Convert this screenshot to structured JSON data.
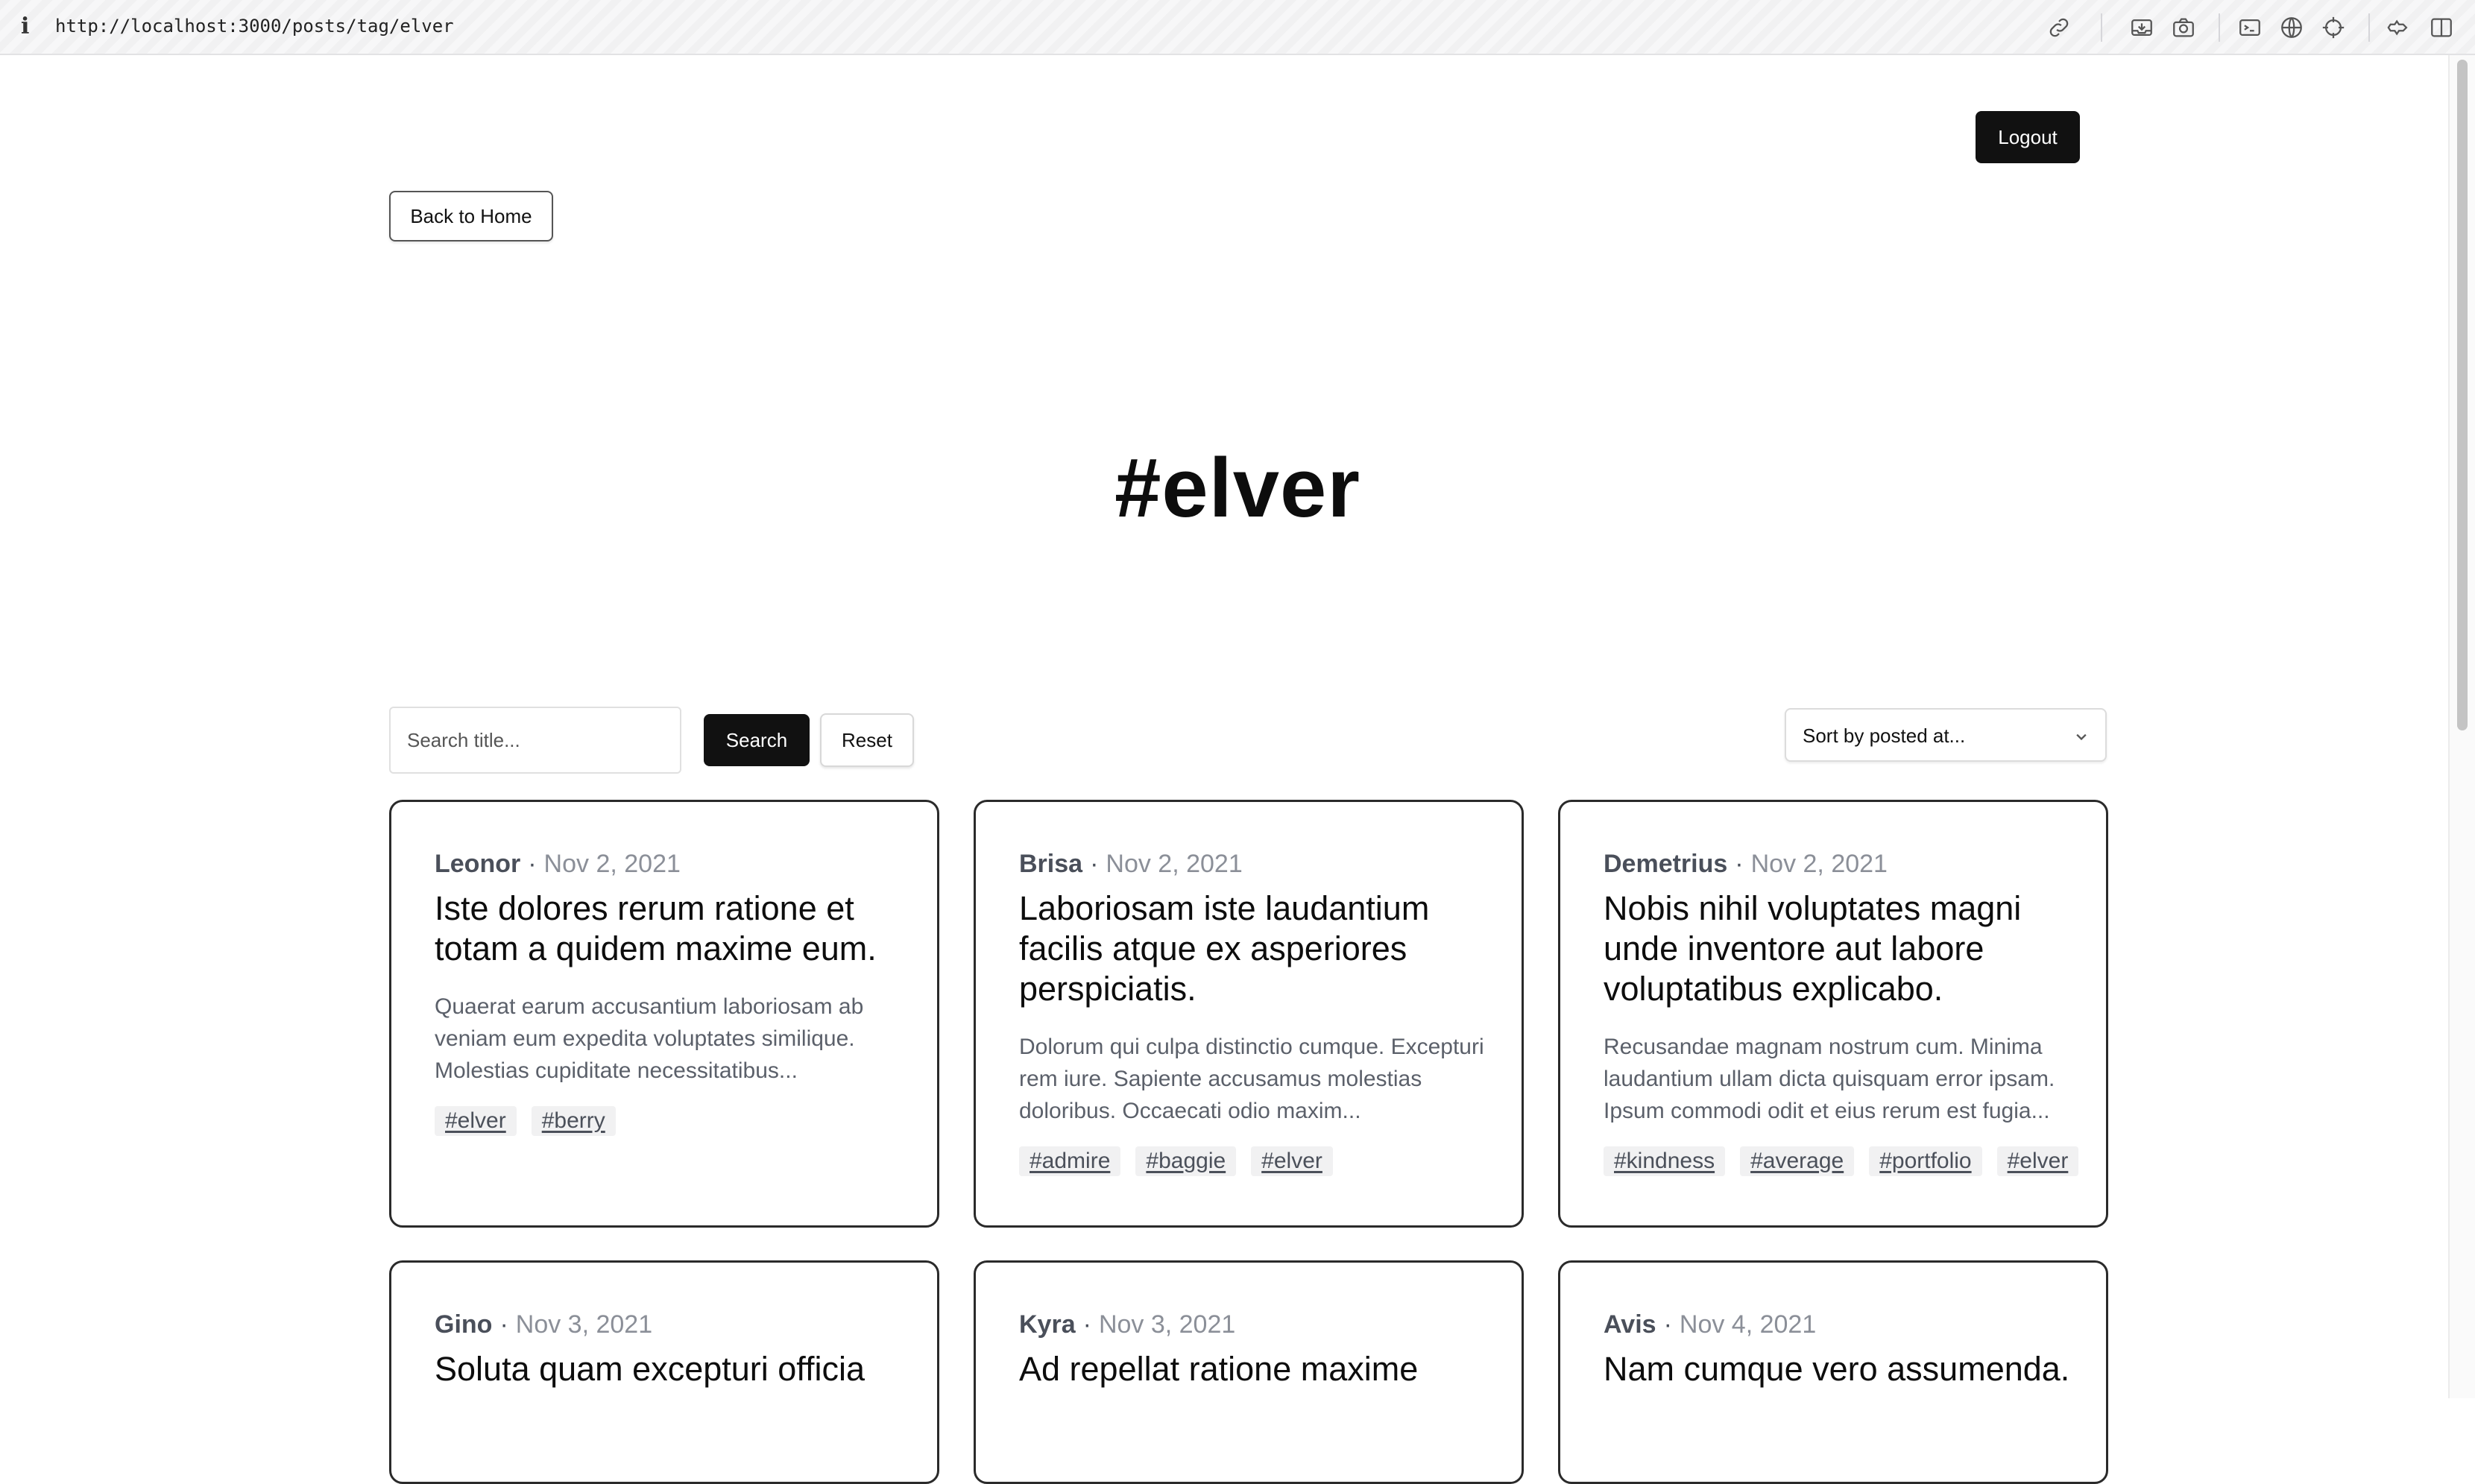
{
  "browser": {
    "url": "http://localhost:3000/posts/tag/elver",
    "info_glyph": "i",
    "toolbar_icons": [
      "link-icon",
      "inbox-icon",
      "camera-icon",
      "terminal-icon",
      "globe-icon",
      "crosshair-icon",
      "extensions-icon",
      "sidebar-icon"
    ]
  },
  "header": {
    "logout_label": "Logout",
    "back_label": "Back to Home"
  },
  "page": {
    "title": "#elver"
  },
  "toolbar": {
    "search_placeholder": "Search title...",
    "search_label": "Search",
    "reset_label": "Reset",
    "sort_label": "Sort by posted at..."
  },
  "posts": [
    {
      "author": "Leonor",
      "date": "Nov 2, 2021",
      "title": "Iste dolores rerum ratione et totam a quidem maxime eum.",
      "excerpt": "Quaerat earum accusantium laboriosam ab veniam eum expedita voluptates similique. Molestias cupiditate necessitatibus...",
      "tags": [
        "#elver",
        "#berry"
      ]
    },
    {
      "author": "Brisa",
      "date": "Nov 2, 2021",
      "title": "Laboriosam iste laudantium facilis atque ex asperiores perspiciatis.",
      "excerpt": "Dolorum qui culpa distinctio cumque. Excepturi rem iure. Sapiente accusamus molestias doloribus. Occaecati odio maxim...",
      "tags": [
        "#admire",
        "#baggie",
        "#elver"
      ]
    },
    {
      "author": "Demetrius",
      "date": "Nov 2, 2021",
      "title": "Nobis nihil voluptates magni unde inventore aut labore voluptatibus explicabo.",
      "excerpt": "Recusandae magnam nostrum cum. Minima laudantium ullam dicta quisquam error ipsam. Ipsum commodi odit et eius rerum est fugia...",
      "tags": [
        "#kindness",
        "#average",
        "#portfolio",
        "#elver"
      ]
    },
    {
      "author": "Gino",
      "date": "Nov 3, 2021",
      "title": "Soluta quam excepturi officia",
      "excerpt": "",
      "tags": []
    },
    {
      "author": "Kyra",
      "date": "Nov 3, 2021",
      "title": "Ad repellat ratione maxime",
      "excerpt": "",
      "tags": []
    },
    {
      "author": "Avis",
      "date": "Nov 4, 2021",
      "title": "Nam cumque vero assumenda.",
      "excerpt": "",
      "tags": []
    }
  ]
}
